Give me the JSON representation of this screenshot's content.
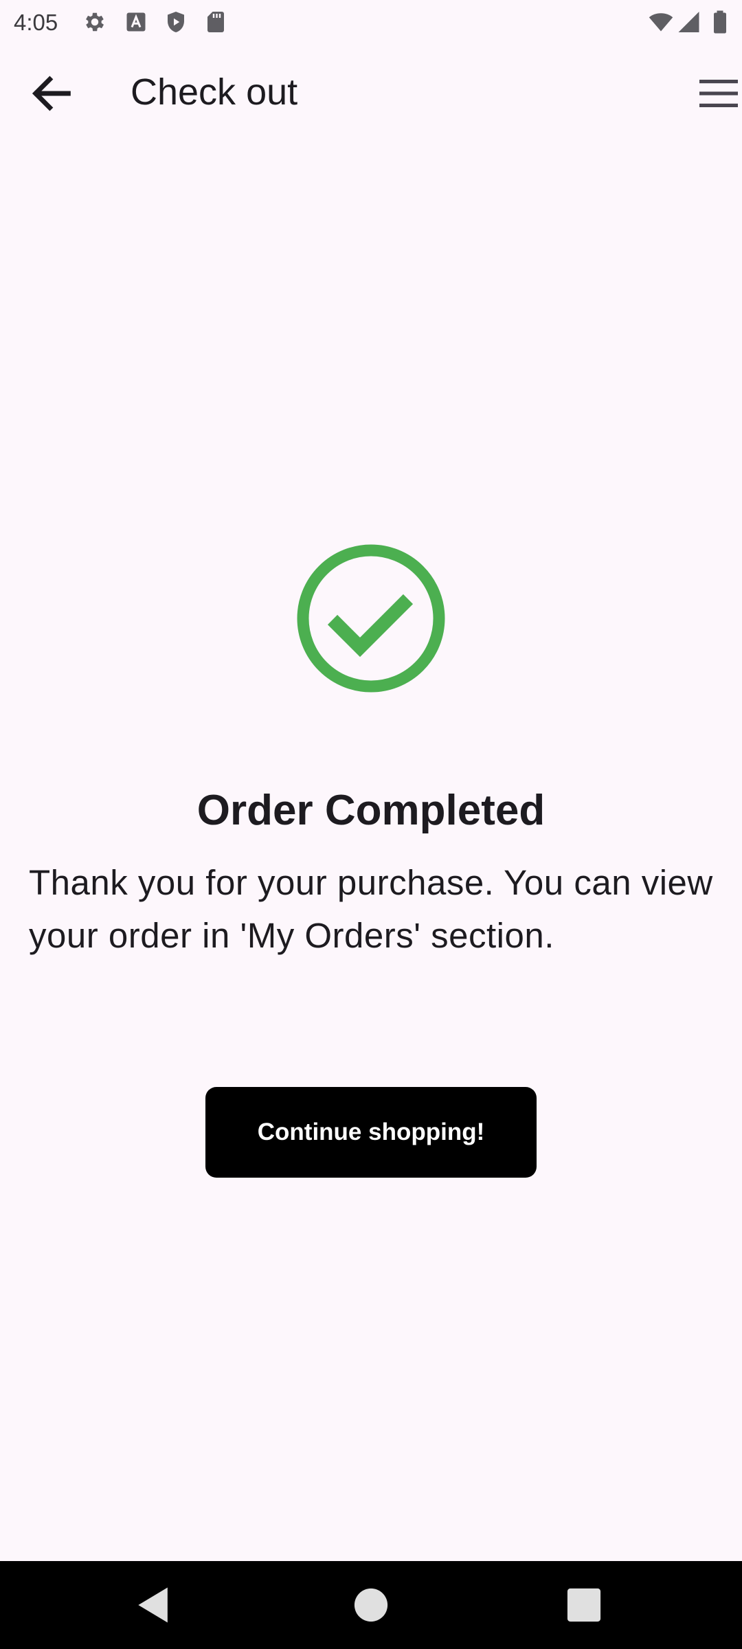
{
  "status_bar": {
    "time": "4:05",
    "icons": [
      "gear-icon",
      "a-badge-icon",
      "shield-play-icon",
      "sd-card-icon",
      "wifi-icon",
      "signal-icon",
      "battery-icon"
    ]
  },
  "app_bar": {
    "title": "Check out",
    "back_icon": "arrow-back-icon",
    "menu_icon": "hamburger-menu-icon"
  },
  "success": {
    "icon": "check-circle-icon",
    "icon_color": "#4CAF50",
    "title": "Order Completed",
    "message": "Thank you for your purchase. You can view your order in 'My Orders' section."
  },
  "actions": {
    "continue_label": "Continue shopping!"
  },
  "nav_bar": {
    "icons": [
      "nav-back-icon",
      "nav-home-icon",
      "nav-recents-icon"
    ]
  },
  "colors": {
    "background": "#FDF7FC",
    "button": "#000000",
    "button_text": "#FFFFFF",
    "accent": "#4CAF50"
  }
}
